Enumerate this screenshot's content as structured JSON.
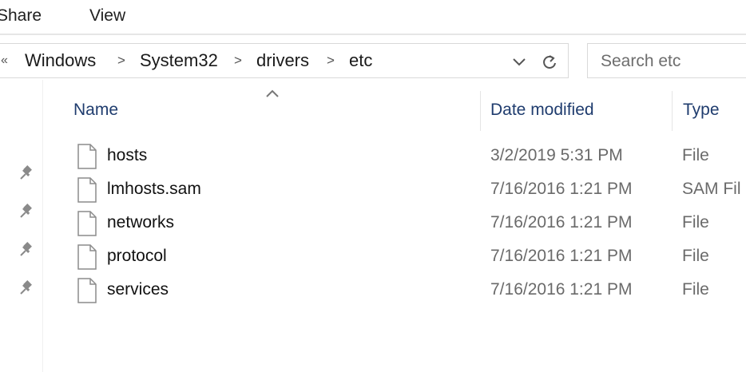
{
  "ribbon": {
    "tabs": [
      "Share",
      "View"
    ]
  },
  "address": {
    "crumbs": [
      "Windows",
      "System32",
      "drivers",
      "etc"
    ],
    "overflow_icon": "double-chevron-left-icon",
    "dropdown_icon": "chevron-down-icon",
    "refresh_icon": "refresh-icon"
  },
  "search": {
    "placeholder": "Search etc"
  },
  "columns": {
    "name": "Name",
    "date": "Date modified",
    "type": "Type",
    "sorted_by": "Name"
  },
  "files": [
    {
      "name": "hosts",
      "date": "3/2/2019 5:31 PM",
      "type": "File"
    },
    {
      "name": "lmhosts.sam",
      "date": "7/16/2016 1:21 PM",
      "type": "SAM Fil"
    },
    {
      "name": "networks",
      "date": "7/16/2016 1:21 PM",
      "type": "File"
    },
    {
      "name": "protocol",
      "date": "7/16/2016 1:21 PM",
      "type": "File"
    },
    {
      "name": "services",
      "date": "7/16/2016 1:21 PM",
      "type": "File"
    }
  ],
  "nav_pins": [
    "pin-icon",
    "pin-icon",
    "pin-icon",
    "pin-icon"
  ],
  "colors": {
    "header_text": "#1f3c6e",
    "meta_text": "#6a6a6a",
    "border": "#d9d9d9"
  }
}
